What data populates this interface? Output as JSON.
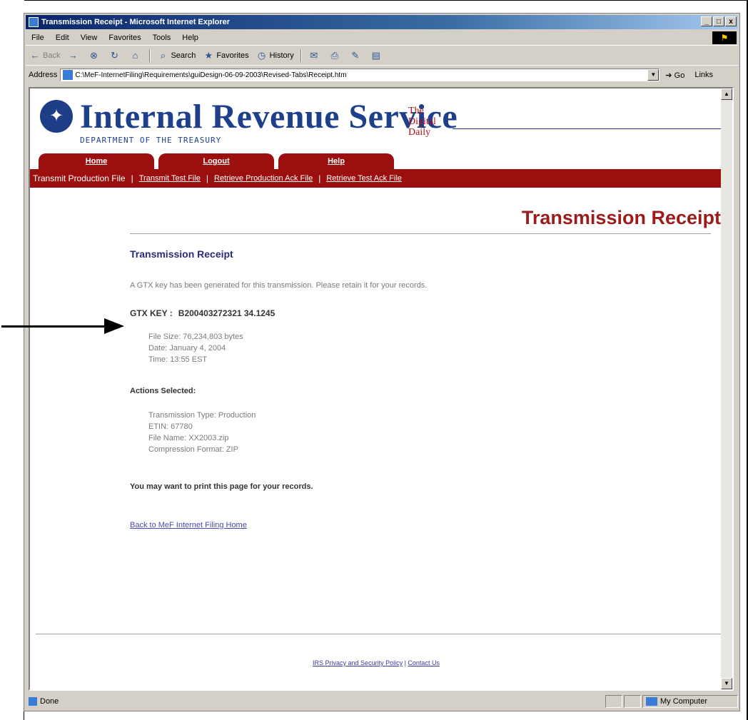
{
  "window": {
    "title": "Transmission Receipt - Microsoft Internet Explorer",
    "min": "_",
    "max": "□",
    "close": "x"
  },
  "menu": [
    "File",
    "Edit",
    "View",
    "Favorites",
    "Tools",
    "Help"
  ],
  "toolbar": {
    "back": "Back",
    "search": "Search",
    "favorites": "Favorites",
    "history": "History"
  },
  "address": {
    "label": "Address",
    "url": "C:\\MeF-InternetFiling\\Requirements\\guiDesign-06-09-2003\\Revised-Tabs\\Receipt.htm",
    "go": "Go",
    "links": "Links"
  },
  "header": {
    "title": "Internal Revenue Service",
    "subtitle": "DEPARTMENT OF THE TREASURY",
    "digital_line1": "The",
    "digital_line2": "Digital",
    "digital_line3": "Daily"
  },
  "tabs": [
    "Home",
    "Logout",
    "Help"
  ],
  "subnav": {
    "current": "Transmit Production File",
    "sep": "|",
    "links": [
      "Transmit Test File",
      "Retrieve Production Ack File",
      "Retrieve Test Ack File"
    ]
  },
  "receipt": {
    "page_heading": "Transmission Receipt",
    "section_title": "Transmission Receipt",
    "intro": "A GTX key has been generated for this transmission. Please retain it for your records.",
    "gtx_label": "GTX KEY :",
    "gtx_value": "B200403272321 34.1245",
    "file_size": "File Size:   76,234,803 bytes",
    "date": "Date:   January 4, 2004",
    "time": "Time:   13:55 EST",
    "actions_title": "Actions Selected:",
    "transmission_type": "Transmission Type:   Production",
    "etin": "ETIN:   67780",
    "file_name": "File Name:   XX2003.zip",
    "compression": "Compression Format:   ZIP",
    "print_note": "You may want to print this page for your records.",
    "back_link": "Back to MeF Internet Filing Home"
  },
  "footer": {
    "privacy": "IRS Privacy and Security Policy",
    "sep": " | ",
    "contact": "Contact Us"
  },
  "status": {
    "done": "Done",
    "zone": "My Computer"
  }
}
